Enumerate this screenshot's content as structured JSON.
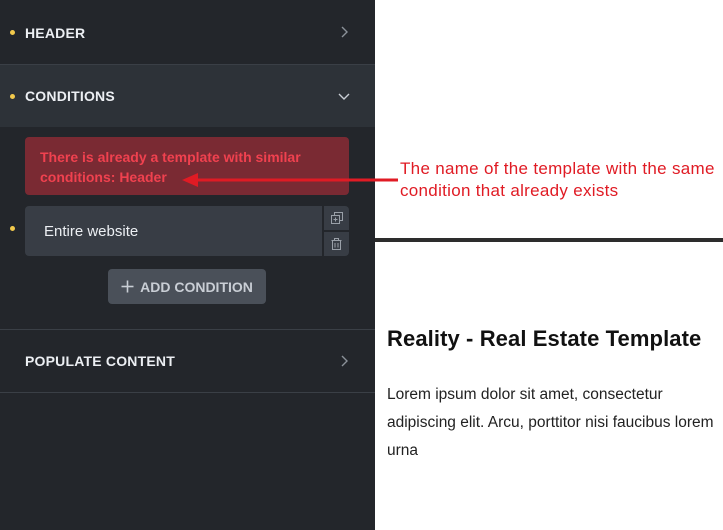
{
  "panel": {
    "sections": {
      "header": {
        "title": "HEADER"
      },
      "conditions": {
        "title": "CONDITIONS"
      },
      "populate": {
        "title": "POPULATE CONTENT"
      }
    },
    "alert": {
      "text": "There is already a template with similar conditions: Header"
    },
    "condition": {
      "value": "Entire website"
    },
    "add_condition": {
      "label": "ADD CONDITION",
      "icon": "plus-icon"
    },
    "icons": {
      "duplicate": "copy-icon",
      "delete": "trash-icon",
      "collapsed": "chevron-right-icon",
      "expanded": "chevron-down-icon"
    }
  },
  "annotation": {
    "text": "The name of the template with the same condition that already exists"
  },
  "preview": {
    "title": "Reality - Real Estate Template",
    "body": "Lorem ipsum dolor sit amet, consectetur adipiscing elit. Arcu, porttitor nisi faucibus lorem urna"
  },
  "colors": {
    "panel_bg": "#23262b",
    "active_section_bg": "#2d3238",
    "alert_bg": "#7a2a33",
    "alert_text": "#f0414f",
    "dot": "#f2c94c",
    "annotation": "#e01b24"
  }
}
